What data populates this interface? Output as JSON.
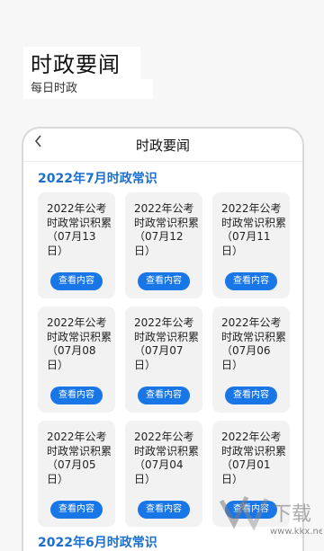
{
  "promo": {
    "title": "时政要闻",
    "subtitle": "每日时政"
  },
  "topbar": {
    "back_icon": "chevron-left-icon",
    "title": "时政要闻"
  },
  "sections": [
    {
      "title": "2022年7月时政常识",
      "cards": [
        {
          "text": "2022年公考时政常识积累（07月13日）",
          "button": "查看内容"
        },
        {
          "text": "2022年公考时政常识积累（07月12日）",
          "button": "查看内容"
        },
        {
          "text": "2022年公考时政常识积累（07月11日）",
          "button": "查看内容"
        },
        {
          "text": "2022年公考时政常识积累（07月08日）",
          "button": "查看内容"
        },
        {
          "text": "2022年公考时政常识积累（07月07日）",
          "button": "查看内容"
        },
        {
          "text": "2022年公考时政常识积累（07月06日）",
          "button": "查看内容"
        },
        {
          "text": "2022年公考时政常识积累（07月05日）",
          "button": "查看内容"
        },
        {
          "text": "2022年公考时政常识积累（07月04日）",
          "button": "查看内容"
        },
        {
          "text": "2022年公考时政常识积累（07月01日）",
          "button": "查看内容"
        }
      ]
    },
    {
      "title": "2022年6月时政常识"
    }
  ],
  "watermark": {
    "brand": "下载",
    "url": "www.kkx.net"
  },
  "colors": {
    "accent": "#1976e6",
    "section_title": "#1b6fcf",
    "card_bg": "#f2f2f2"
  }
}
